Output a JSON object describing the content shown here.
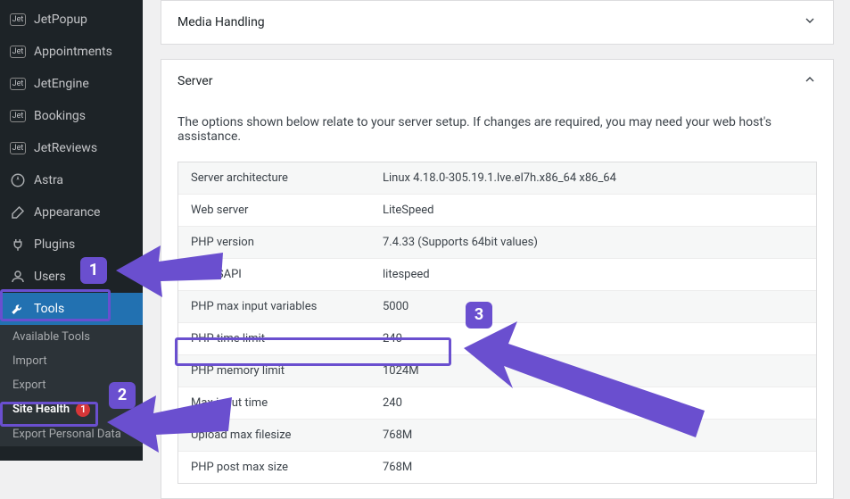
{
  "sidebar": {
    "jet": [
      {
        "label": "JetPopup"
      },
      {
        "label": "Appointments"
      },
      {
        "label": "JetEngine"
      },
      {
        "label": "Bookings"
      },
      {
        "label": "JetReviews"
      }
    ],
    "astra": {
      "label": "Astra"
    },
    "appearance": {
      "label": "Appearance"
    },
    "plugins": {
      "label": "Plugins"
    },
    "users": {
      "label": "Users"
    },
    "tools": {
      "label": "Tools"
    },
    "subs": {
      "available": "Available Tools",
      "import": "Import",
      "export": "Export",
      "site_health": "Site Health",
      "site_health_badge": "1",
      "export_personal": "Export Personal Data"
    }
  },
  "panels": {
    "media": {
      "title": "Media Handling"
    },
    "server": {
      "title": "Server",
      "desc": "The options shown below relate to your server setup. If changes are required, you may need your web host's assistance.",
      "rows": [
        {
          "label": "Server architecture",
          "value": "Linux 4.18.0-305.19.1.lve.el7h.x86_64 x86_64"
        },
        {
          "label": "Web server",
          "value": "LiteSpeed"
        },
        {
          "label": "PHP version",
          "value": "7.4.33 (Supports 64bit values)"
        },
        {
          "label": "PHP SAPI",
          "value": "litespeed"
        },
        {
          "label": "PHP max input variables",
          "value": "5000"
        },
        {
          "label": "PHP time limit",
          "value": "240"
        },
        {
          "label": "PHP memory limit",
          "value": "1024M"
        },
        {
          "label": "Max input time",
          "value": "240"
        },
        {
          "label": "Upload max filesize",
          "value": "768M"
        },
        {
          "label": "PHP post max size",
          "value": "768M"
        }
      ]
    }
  },
  "callouts": {
    "c1": "1",
    "c2": "2",
    "c3": "3"
  }
}
